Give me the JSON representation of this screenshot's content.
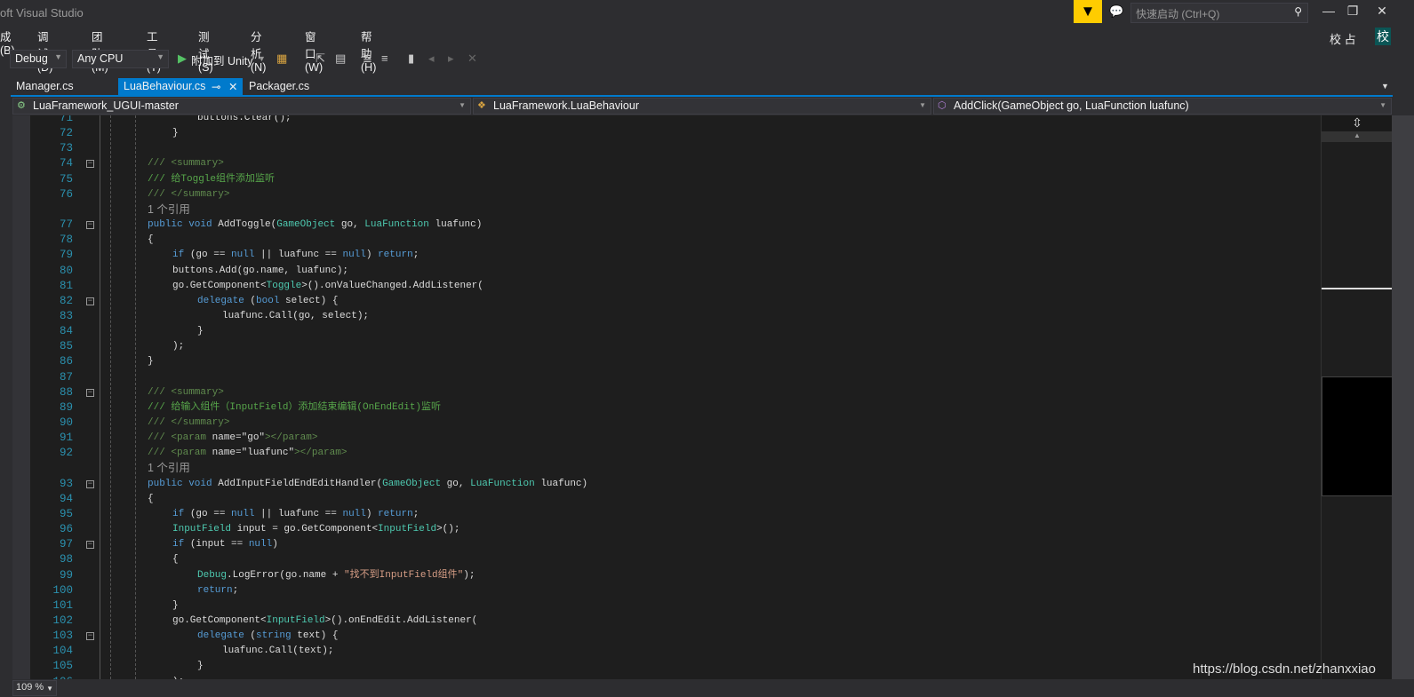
{
  "window": {
    "title": "oft Visual Studio",
    "quick_launch": "快速启动 (Ctrl+Q)",
    "user": "校 占",
    "avatar": "校"
  },
  "menu": [
    "成(B)",
    "调试(D)",
    "团队(M)",
    "工具(T)",
    "测试(S)",
    "分析(N)",
    "窗口(W)",
    "帮助(H)"
  ],
  "toolbar": {
    "config": "Debug",
    "platform": "Any CPU",
    "attach": "附加到 Unity"
  },
  "tabs": [
    {
      "label": "Manager.cs",
      "active": false
    },
    {
      "label": "LuaBehaviour.cs",
      "active": true
    },
    {
      "label": "Packager.cs",
      "active": false
    }
  ],
  "navbar": {
    "project": "LuaFramework_UGUI-master",
    "class": "LuaFramework.LuaBehaviour",
    "member": "AddClick(GameObject go, LuaFunction luafunc)"
  },
  "status": {
    "zoom": "109 %"
  },
  "watermark": "https://blog.csdn.net/zhanxxiao",
  "colors": {
    "accent": "#007acc",
    "keyword": "#569cd6",
    "type": "#4ec9b0",
    "comment": "#57a64a",
    "string": "#d69d85",
    "line_number": "#2b91af"
  },
  "lines": [
    {
      "n": "71",
      "i": 4,
      "t": [
        [
          "buttons.Clear();",
          "tx"
        ]
      ]
    },
    {
      "n": "72",
      "i": 3,
      "t": [
        [
          "}",
          "tx"
        ]
      ]
    },
    {
      "n": "73",
      "i": 0,
      "t": []
    },
    {
      "n": "74",
      "i": 2,
      "f": 1,
      "t": [
        [
          "/// ",
          "cg"
        ],
        [
          "<summary>",
          "cg"
        ]
      ]
    },
    {
      "n": "75",
      "i": 2,
      "t": [
        [
          "/// 给Toggle组件添加监听",
          "cm"
        ]
      ]
    },
    {
      "n": "76",
      "i": 2,
      "t": [
        [
          "/// ",
          "cg"
        ],
        [
          "</summary>",
          "cg"
        ]
      ]
    },
    {
      "n": "",
      "i": 2,
      "lens": "1 个引用"
    },
    {
      "n": "77",
      "i": 2,
      "f": 1,
      "t": [
        [
          "public void ",
          "kw"
        ],
        [
          "AddToggle(",
          "tx"
        ],
        [
          "GameObject",
          "ty"
        ],
        [
          " go, ",
          "tx"
        ],
        [
          "LuaFunction",
          "ty"
        ],
        [
          " luafunc)",
          "tx"
        ]
      ]
    },
    {
      "n": "78",
      "i": 2,
      "t": [
        [
          "{",
          "tx"
        ]
      ]
    },
    {
      "n": "79",
      "i": 3,
      "t": [
        [
          "if ",
          "kw"
        ],
        [
          "(go == ",
          "tx"
        ],
        [
          "null",
          "kw"
        ],
        [
          " || luafunc == ",
          "tx"
        ],
        [
          "null",
          "kw"
        ],
        [
          ") ",
          "tx"
        ],
        [
          "return",
          "kw"
        ],
        [
          ";",
          "tx"
        ]
      ]
    },
    {
      "n": "80",
      "i": 3,
      "t": [
        [
          "buttons.Add(go.name, luafunc);",
          "tx"
        ]
      ]
    },
    {
      "n": "81",
      "i": 3,
      "t": [
        [
          "go.GetComponent<",
          "tx"
        ],
        [
          "Toggle",
          "ty"
        ],
        [
          ">().onValueChanged.AddListener(",
          "tx"
        ]
      ]
    },
    {
      "n": "82",
      "i": 4,
      "f": 1,
      "t": [
        [
          "delegate ",
          "kw"
        ],
        [
          "(",
          "tx"
        ],
        [
          "bool",
          "kw"
        ],
        [
          " select) {",
          "tx"
        ]
      ]
    },
    {
      "n": "83",
      "i": 5,
      "t": [
        [
          "luafunc.Call(go, select);",
          "tx"
        ]
      ]
    },
    {
      "n": "84",
      "i": 4,
      "t": [
        [
          "}",
          "tx"
        ]
      ]
    },
    {
      "n": "85",
      "i": 3,
      "t": [
        [
          ");",
          "tx"
        ]
      ]
    },
    {
      "n": "86",
      "i": 2,
      "t": [
        [
          "}",
          "tx"
        ]
      ]
    },
    {
      "n": "87",
      "i": 0,
      "t": []
    },
    {
      "n": "88",
      "i": 2,
      "f": 1,
      "t": [
        [
          "/// <summary>",
          "cg"
        ]
      ]
    },
    {
      "n": "89",
      "i": 2,
      "t": [
        [
          "/// 给输入组件（InputField）添加结束编辑(OnEndEdit)监听",
          "cm"
        ]
      ]
    },
    {
      "n": "90",
      "i": 2,
      "t": [
        [
          "/// </summary>",
          "cg"
        ]
      ]
    },
    {
      "n": "91",
      "i": 2,
      "t": [
        [
          "/// <param ",
          "cg"
        ],
        [
          "name=\"go\"",
          "tx"
        ],
        [
          "></param>",
          "cg"
        ]
      ]
    },
    {
      "n": "92",
      "i": 2,
      "t": [
        [
          "/// <param ",
          "cg"
        ],
        [
          "name=\"luafunc\"",
          "tx"
        ],
        [
          "></param>",
          "cg"
        ]
      ]
    },
    {
      "n": "",
      "i": 2,
      "lens": "1 个引用"
    },
    {
      "n": "93",
      "i": 2,
      "f": 1,
      "t": [
        [
          "public void ",
          "kw"
        ],
        [
          "AddInputFieldEndEditHandler(",
          "tx"
        ],
        [
          "GameObject",
          "ty"
        ],
        [
          " go, ",
          "tx"
        ],
        [
          "LuaFunction",
          "ty"
        ],
        [
          " luafunc)",
          "tx"
        ]
      ]
    },
    {
      "n": "94",
      "i": 2,
      "t": [
        [
          "{",
          "tx"
        ]
      ]
    },
    {
      "n": "95",
      "i": 3,
      "t": [
        [
          "if ",
          "kw"
        ],
        [
          "(go == ",
          "tx"
        ],
        [
          "null",
          "kw"
        ],
        [
          " || luafunc == ",
          "tx"
        ],
        [
          "null",
          "kw"
        ],
        [
          ") ",
          "tx"
        ],
        [
          "return",
          "kw"
        ],
        [
          ";",
          "tx"
        ]
      ]
    },
    {
      "n": "96",
      "i": 3,
      "t": [
        [
          "InputField",
          "ty"
        ],
        [
          " input = go.GetComponent<",
          "tx"
        ],
        [
          "InputField",
          "ty"
        ],
        [
          ">();",
          "tx"
        ]
      ]
    },
    {
      "n": "97",
      "i": 3,
      "f": 1,
      "t": [
        [
          "if ",
          "kw"
        ],
        [
          "(input == ",
          "tx"
        ],
        [
          "null",
          "kw"
        ],
        [
          ")",
          "tx"
        ]
      ]
    },
    {
      "n": "98",
      "i": 3,
      "t": [
        [
          "{",
          "tx"
        ]
      ]
    },
    {
      "n": "99",
      "i": 4,
      "t": [
        [
          "Debug",
          "ty"
        ],
        [
          ".LogError(go.name + ",
          "tx"
        ],
        [
          "\"找不到InputField组件\"",
          "st"
        ],
        [
          ");",
          "tx"
        ]
      ]
    },
    {
      "n": "100",
      "i": 4,
      "t": [
        [
          "return",
          "kw"
        ],
        [
          ";",
          "tx"
        ]
      ]
    },
    {
      "n": "101",
      "i": 3,
      "t": [
        [
          "}",
          "tx"
        ]
      ]
    },
    {
      "n": "102",
      "i": 3,
      "t": [
        [
          "go.GetComponent<",
          "tx"
        ],
        [
          "InputField",
          "ty"
        ],
        [
          ">().onEndEdit.AddListener(",
          "tx"
        ]
      ]
    },
    {
      "n": "103",
      "i": 4,
      "f": 1,
      "t": [
        [
          "delegate ",
          "kw"
        ],
        [
          "(",
          "tx"
        ],
        [
          "string",
          "kw"
        ],
        [
          " text) {",
          "tx"
        ]
      ]
    },
    {
      "n": "104",
      "i": 5,
      "t": [
        [
          "luafunc.Call(text);",
          "tx"
        ]
      ]
    },
    {
      "n": "105",
      "i": 4,
      "t": [
        [
          "}",
          "tx"
        ]
      ]
    },
    {
      "n": "106",
      "i": 3,
      "t": [
        [
          ");",
          "tx"
        ]
      ]
    }
  ]
}
